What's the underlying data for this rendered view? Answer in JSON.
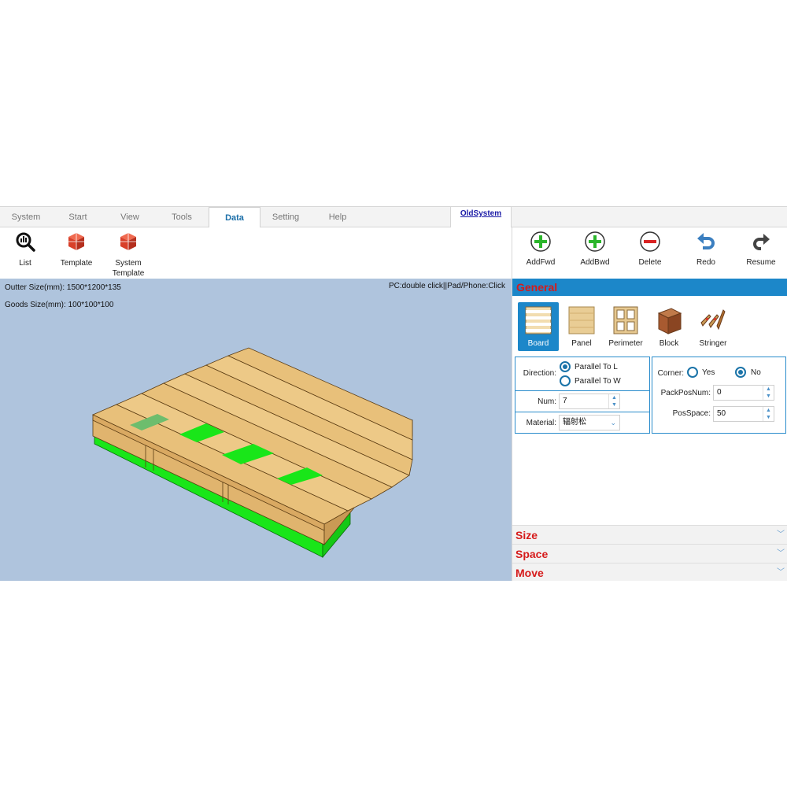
{
  "tabs": [
    {
      "label": "System"
    },
    {
      "label": "Start"
    },
    {
      "label": "View"
    },
    {
      "label": "Tools"
    },
    {
      "label": "Data"
    },
    {
      "label": "Setting"
    },
    {
      "label": "Help"
    }
  ],
  "active_tab": "Data",
  "old_system_link": "OldSystem",
  "ribbon": {
    "list_label": "List",
    "template_label": "Template",
    "system_template_label_1": "System",
    "system_template_label_2": "Template"
  },
  "toolbar": {
    "addfwd": "AddFwd",
    "addbwd": "AddBwd",
    "delete": "Delete",
    "redo": "Redo",
    "resume": "Resume"
  },
  "viewport": {
    "outer_size": "Outter Size(mm): 1500*1200*135",
    "goods_size": "Goods Size(mm): 100*100*100",
    "hint": "PC:double click||Pad/Phone:Click"
  },
  "panel": {
    "general": "General",
    "types": [
      {
        "label": "Board",
        "selected": true
      },
      {
        "label": "Panel",
        "selected": false
      },
      {
        "label": "Perimeter",
        "selected": false
      },
      {
        "label": "Block",
        "selected": false
      },
      {
        "label": "Stringer",
        "selected": false
      }
    ],
    "direction_label": "Direction:",
    "direction_options": [
      "Parallel To L",
      "Parallel To W"
    ],
    "direction_selected": 0,
    "num_label": "Num:",
    "num_value": "7",
    "material_label": "Material:",
    "material_value": "辐射松",
    "corner_label": "Corner:",
    "corner_yes": "Yes",
    "corner_no": "No",
    "corner_selected": "No",
    "packposnum_label": "PackPosNum:",
    "packposnum_value": "0",
    "posspace_label": "PosSpace:",
    "posspace_value": "50",
    "sections": [
      "Size",
      "Space",
      "Move"
    ]
  },
  "colors": {
    "accent": "#1c87c9",
    "section_title": "#d61b1b",
    "viewport_bg": "#afc4dd",
    "wood": "#e8c07a",
    "runner": "#19e619"
  }
}
